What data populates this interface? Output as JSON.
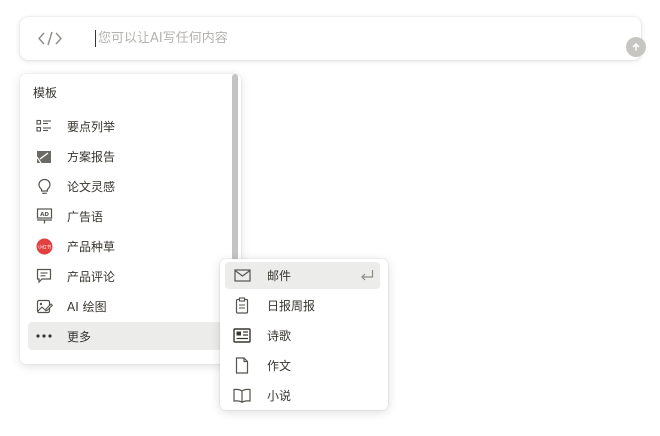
{
  "ai_bar": {
    "placeholder": "您可以让AI写任何内容",
    "icon": "code-icon",
    "submit_icon": "arrow-up-icon"
  },
  "template_panel": {
    "title": "模板",
    "items": [
      {
        "label": "要点列举",
        "icon": "bullet-list-icon"
      },
      {
        "label": "方案报告",
        "icon": "report-icon"
      },
      {
        "label": "论文灵感",
        "icon": "lightbulb-icon"
      },
      {
        "label": "广告语",
        "icon": "ad-board-icon"
      },
      {
        "label": "产品种草",
        "icon": "xiaohongshu-icon",
        "badge_text": "小红书"
      },
      {
        "label": "产品评论",
        "icon": "comment-icon"
      },
      {
        "label": "AI 绘图",
        "icon": "image-edit-icon"
      },
      {
        "label": "更多",
        "icon": "more-dots-icon"
      }
    ]
  },
  "submenu": {
    "items": [
      {
        "label": "邮件",
        "icon": "mail-icon"
      },
      {
        "label": "日报周报",
        "icon": "clipboard-icon"
      },
      {
        "label": "诗歌",
        "icon": "newspaper-icon"
      },
      {
        "label": "作文",
        "icon": "document-icon"
      },
      {
        "label": "小说",
        "icon": "book-icon"
      }
    ],
    "enter_icon": "enter-return-icon"
  },
  "colors": {
    "text": "#37352f",
    "icon": "#55534e",
    "placeholder": "#b4b3ae",
    "hover": "#ececeb",
    "badge": "#e23f3f",
    "submit": "#c6c5c2"
  }
}
